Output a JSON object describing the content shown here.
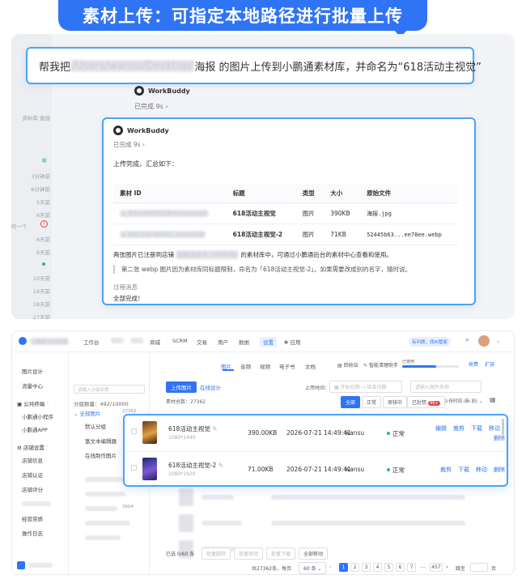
{
  "banner": {
    "title": "素材上传：可指定本地路径进行批量上传"
  },
  "chat": {
    "prompt": {
      "prefix": "帮我把",
      "path_blurred": "/Users/wansu/Desktop/",
      "suffix": "海报 的图片上传到小鹏通素材库，并命名为“618活动主视觉”"
    },
    "sidebar": {
      "label": "资料库·直接",
      "times": [
        "3分钟前",
        "6分钟前",
        "5天前",
        "6天前",
        "的一个",
        "6天前",
        "6天前",
        "6天前",
        "10天前",
        "16天前",
        "18天前",
        "27天前"
      ]
    },
    "outer_reply": {
      "agent": "WorkBuddy",
      "status": "已完成 9s ›"
    },
    "answer": {
      "agent": "WorkBuddy",
      "status": "已完成 9s ›",
      "summary": "上传完成，汇总如下：",
      "table": {
        "headers": [
          "素材 ID",
          "标题",
          "类型",
          "大小",
          "原始文件"
        ],
        "rows": [
          {
            "id": "a_iF6m0N0Ns5RnLmruaasJ9",
            "title": "618活动主视觉",
            "type": "图片",
            "size": "390KB",
            "file": "海报.jpg"
          },
          {
            "id": "a_MkL5vJF9d0Xd_mruaasJ9",
            "title": "618活动主视觉-2",
            "type": "图片",
            "size": "71KB",
            "file": "52445b63...ee78ee.webp"
          }
        ]
      },
      "note_prefix": "两张图片已注册到店铺",
      "note_blurred": "鹤鹏通用号 (TAFA5B)",
      "note_suffix": "的素材库中，可通过小鹏通后台的素材中心查看和使用。",
      "quote": "第二张 webp 图片因为素材库同标题限制，命名为「618活动主视觉-2」。如果需要改成别的名字，随时说。",
      "process": "过程消息",
      "final": "全部完成！"
    }
  },
  "app": {
    "brand_blurred": "小鹏通 知识店铺",
    "top_nav": [
      "工作台",
      "商城",
      "SCRM",
      "交易",
      "用户",
      "数据",
      "设置",
      "应用"
    ],
    "top_nav_active": "设置",
    "top_right": {
      "badge": "有问题，找AI管家",
      "storage_label": "已使用",
      "renew": "续费",
      "expand": "扩容"
    },
    "left_menu": {
      "items_top": [
        "图片设计",
        "流量中心"
      ],
      "group1": "公共终端",
      "group1_items": [
        "小鹏通小程序",
        "小鹏通APP"
      ],
      "group2": "店铺设置",
      "group2_items": [
        "店铺信息",
        "店铺认证",
        "店铺评分",
        "经营资质",
        "操作日志"
      ]
    },
    "tabs": [
      "图片",
      "音频",
      "视频",
      "电子书",
      "文档"
    ],
    "tabs_active": "图片",
    "tree": {
      "search_placeholder": "请输入分组名称",
      "count": "分组数量：492/10000",
      "items": [
        "全部图片",
        "默认分组",
        "富文本编辑器",
        "在线制作图片"
      ],
      "all_count": "27362"
    },
    "toolbar": {
      "upload": "上传图片",
      "online": "在线设计",
      "recycle": "回收站",
      "clean": "智能清理助手",
      "total": "素材总数：27362",
      "upload_time": "上传时间：",
      "start_date": "开始日期",
      "end_date": "结束日期",
      "search_placeholder": "请输入图片名称",
      "filters": [
        "全部",
        "正常",
        "审核中",
        "已封禁"
      ],
      "filter_active": "全部",
      "banned_count": "99+",
      "sort": "上传时间 (新-旧)"
    },
    "assets": [
      {
        "title": "618活动主视觉",
        "dim": "1080*1440",
        "size": "390.00KB",
        "time": "2026-07-21 14:49:41",
        "user": "wansu",
        "status": "正常",
        "actions": [
          "编辑",
          "裁剪",
          "下载",
          "移动",
          "删除"
        ]
      },
      {
        "title": "618活动主视觉-2",
        "dim": "1080*1920",
        "size": "71.00KB",
        "time": "2026-07-21 14:49:41",
        "user": "wansu",
        "status": "正常",
        "actions": [
          "裁剪",
          "下载",
          "移动",
          "删除"
        ]
      }
    ],
    "tree_counts": [
      "3604"
    ],
    "bottom": {
      "selected": "已选 0/60 条",
      "batch_delete": "批量删除",
      "batch_move": "批量移动",
      "batch_download": "批量下载",
      "move_all": "全部移动",
      "total": "共27362条，每页",
      "per_page": "60 条",
      "pages": [
        "1",
        "2",
        "3",
        "4",
        "5",
        "6",
        "7",
        "...",
        "457"
      ],
      "page_active": "1",
      "jump": "跳至",
      "page_unit": "页"
    }
  }
}
